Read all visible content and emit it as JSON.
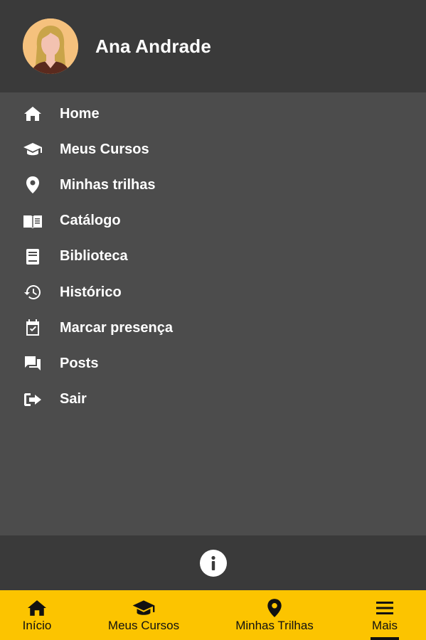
{
  "profile": {
    "name": "Ana Andrade",
    "avatar_icon": "user-avatar"
  },
  "menu": {
    "items": [
      {
        "label": "Home",
        "icon": "home-icon"
      },
      {
        "label": "Meus Cursos",
        "icon": "graduation-cap-icon"
      },
      {
        "label": "Minhas trilhas",
        "icon": "map-pin-icon"
      },
      {
        "label": "Catálogo",
        "icon": "open-book-icon"
      },
      {
        "label": "Biblioteca",
        "icon": "book-icon"
      },
      {
        "label": "Histórico",
        "icon": "history-icon"
      },
      {
        "label": "Marcar presença",
        "icon": "calendar-check-icon"
      },
      {
        "label": "Posts",
        "icon": "chat-bubbles-icon"
      },
      {
        "label": "Sair",
        "icon": "logout-icon"
      }
    ]
  },
  "info": {
    "icon": "info-icon"
  },
  "bottom_nav": {
    "items": [
      {
        "label": "Início",
        "icon": "home-icon",
        "active": false
      },
      {
        "label": "Meus Cursos",
        "icon": "graduation-cap-icon",
        "active": false
      },
      {
        "label": "Minhas Trilhas",
        "icon": "map-pin-icon",
        "active": false
      },
      {
        "label": "Mais",
        "icon": "hamburger-menu-icon",
        "active": true
      }
    ]
  },
  "colors": {
    "header_bg": "#3a3a3a",
    "drawer_bg": "#4c4c4c",
    "accent": "#fcc400",
    "text": "#ffffff",
    "nav_text": "#111111"
  }
}
